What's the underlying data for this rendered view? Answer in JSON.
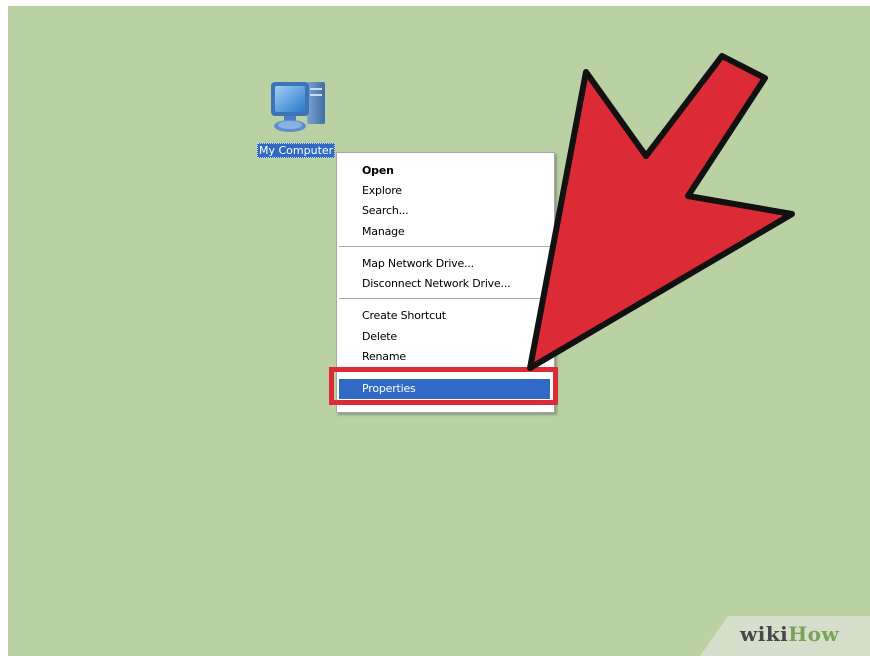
{
  "desktop": {
    "background_color": "#b9d1a3",
    "icon": {
      "name": "my-computer-icon",
      "label": "My Computer"
    }
  },
  "context_menu": {
    "groups": [
      [
        "Open",
        "Explore",
        "Search...",
        "Manage"
      ],
      [
        "Map Network Drive...",
        "Disconnect Network Drive..."
      ],
      [
        "Create Shortcut",
        "Delete",
        "Rename"
      ],
      [
        "Properties"
      ]
    ],
    "default_item": "Open",
    "selected_item": "Properties",
    "selection_color": "#316ac5"
  },
  "annotation": {
    "arrow_color": "#dc2a36",
    "arrow_icon": "red-pointer-arrow-icon",
    "highlight_color": "#dc2a36"
  },
  "watermark": {
    "part1": "wiki",
    "part2": "How"
  }
}
